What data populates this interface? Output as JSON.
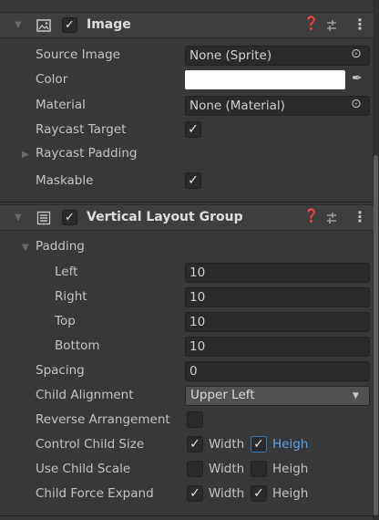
{
  "image_component": {
    "title": "Image",
    "enabled": true,
    "icons": [
      "help-icon",
      "presets-icon",
      "menu-icon"
    ],
    "properties": {
      "source_image": {
        "label": "Source Image",
        "value": "None (Sprite)"
      },
      "color": {
        "label": "Color",
        "value": "#ffffff"
      },
      "material": {
        "label": "Material",
        "value": "None (Material)"
      },
      "raycast_target": {
        "label": "Raycast Target",
        "checked": true
      },
      "raycast_padding": {
        "label": "Raycast Padding",
        "expanded": false
      },
      "maskable": {
        "label": "Maskable",
        "checked": true
      }
    }
  },
  "vertical_layout_group": {
    "title": "Vertical Layout Group",
    "enabled": true,
    "padding": {
      "label": "Padding",
      "expanded": true,
      "left": {
        "label": "Left",
        "value": "10"
      },
      "right": {
        "label": "Right",
        "value": "10"
      },
      "top": {
        "label": "Top",
        "value": "10"
      },
      "bottom": {
        "label": "Bottom",
        "value": "10"
      }
    },
    "spacing": {
      "label": "Spacing",
      "value": "0"
    },
    "child_alignment": {
      "label": "Child Alignment",
      "value": "Upper Left"
    },
    "reverse_arrangement": {
      "label": "Reverse Arrangement",
      "checked": false
    },
    "control_child_size": {
      "label": "Control Child Size",
      "width_label": "Width",
      "width_checked": true,
      "height_label": "Heigh",
      "height_checked": true
    },
    "use_child_scale": {
      "label": "Use Child Scale",
      "width_label": "Width",
      "width_checked": false,
      "height_label": "Heigh",
      "height_checked": false
    },
    "child_force_expand": {
      "label": "Child Force Expand",
      "width_label": "Width",
      "width_checked": true,
      "height_label": "Heigh",
      "height_checked": true
    }
  },
  "colors": {
    "panel_bg": "#383838",
    "field_bg": "#2a2a2a",
    "highlight": "#5aa3f0"
  }
}
